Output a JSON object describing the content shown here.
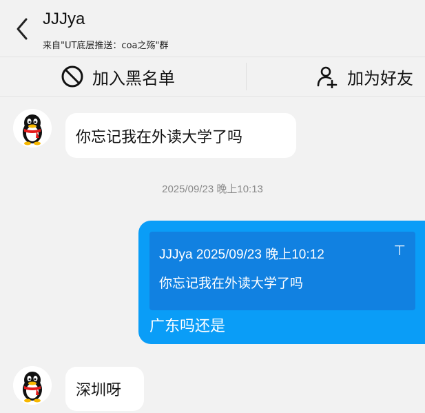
{
  "header": {
    "title": "JJJya",
    "subtitle": "来自\"UT底层推送：coa之殇\"群"
  },
  "actions": {
    "block_label": "加入黑名单",
    "add_friend_label": "加为好友"
  },
  "messages": [
    {
      "direction": "incoming",
      "text": "你忘记我在外读大学了吗"
    },
    {
      "direction": "outgoing",
      "quote": {
        "sender": "JJJya",
        "time": "2025/09/23 晚上10:12",
        "text": "你忘记我在外读大学了吗"
      },
      "text": "广东吗还是"
    },
    {
      "direction": "incoming",
      "text": "深圳呀"
    }
  ],
  "timestamp": "2025/09/23 晚上10:13",
  "quote_header": "JJJya 2025/09/23 晚上10:12",
  "quote_pin_icon": "⊤",
  "colors": {
    "outgoing_bubble": "#0a9df7",
    "quote_bg": "#1181e1",
    "background": "#f2f2f2"
  }
}
